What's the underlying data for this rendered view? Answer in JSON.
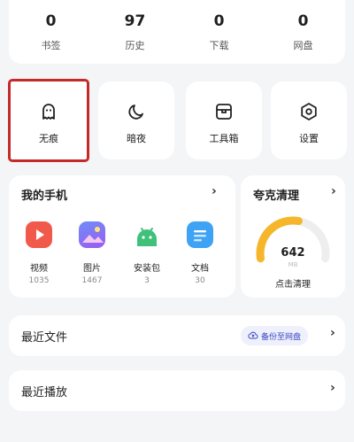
{
  "stats": [
    {
      "value": "0",
      "label": "书签"
    },
    {
      "value": "97",
      "label": "历史"
    },
    {
      "value": "0",
      "label": "下载"
    },
    {
      "value": "0",
      "label": "网盘"
    }
  ],
  "quick_actions": [
    {
      "label": "无痕",
      "icon": "ghost-icon"
    },
    {
      "label": "暗夜",
      "icon": "moon-icon"
    },
    {
      "label": "工具箱",
      "icon": "toolbox-icon"
    },
    {
      "label": "设置",
      "icon": "settings-icon"
    }
  ],
  "my_phone": {
    "title": "我的手机",
    "items": [
      {
        "label": "视频",
        "count": "1035",
        "icon": "video-icon",
        "color": "#f15a4a"
      },
      {
        "label": "图片",
        "count": "1467",
        "icon": "image-icon",
        "color": "#7a63f0"
      },
      {
        "label": "安装包",
        "count": "3",
        "icon": "android-icon",
        "color": "#3fc17a"
      },
      {
        "label": "文档",
        "count": "30",
        "icon": "document-icon",
        "color": "#3ea3f4"
      }
    ]
  },
  "cleaner": {
    "title": "夸克清理",
    "value": "642",
    "unit": "MB",
    "action": "点击清理",
    "gauge_fraction": 0.55,
    "gauge_color": "#f5b62b"
  },
  "recent_files": {
    "title": "最近文件",
    "backup_label": "备份至网盘"
  },
  "recent_play": {
    "title": "最近播放"
  }
}
